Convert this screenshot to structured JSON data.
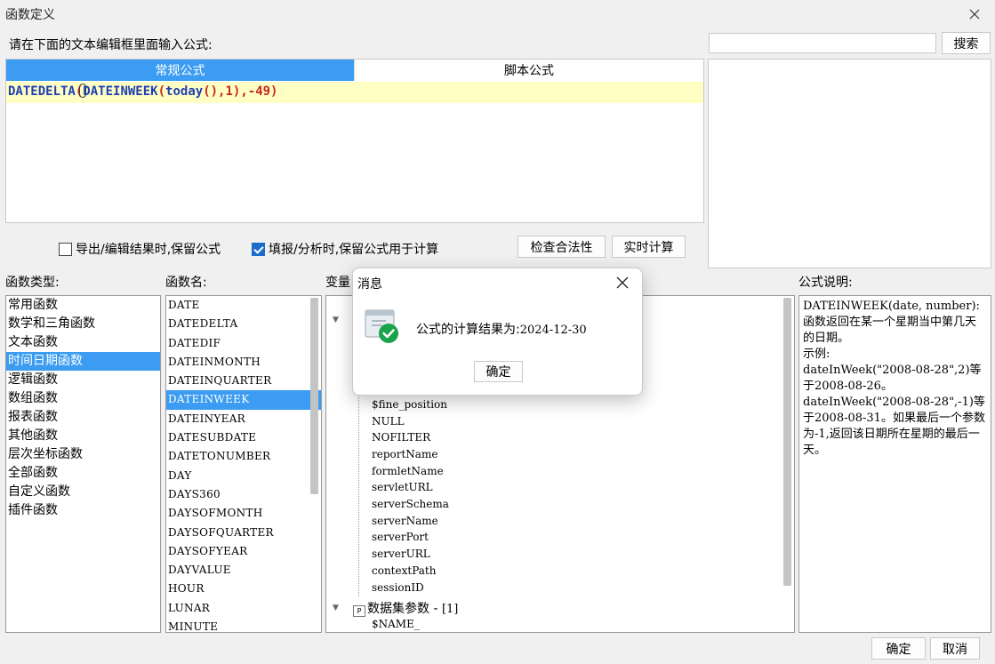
{
  "window": {
    "title": "函数定义",
    "close_icon": "close-icon"
  },
  "editor": {
    "prompt": "请在下面的文本编辑框里面输入公式:",
    "tabs": [
      {
        "label": "常规公式",
        "active": true
      },
      {
        "label": "脚本公式",
        "active": false
      }
    ],
    "formula_parts": {
      "fn1": "DATEDELTA",
      "p1": "(",
      "fn2": "DATEINWEEK",
      "p2": "(",
      "fn3": "today",
      "p3": "()",
      "args": ",1),-49)"
    }
  },
  "search": {
    "value": "",
    "button": "搜索"
  },
  "options": {
    "export_keep": {
      "label": "导出/编辑结果时,保留公式",
      "checked": false
    },
    "fill_keep": {
      "label": "填报/分析时,保留公式用于计算",
      "checked": true
    },
    "check_button": "检查合法性",
    "realtime_button": "实时计算"
  },
  "labels": {
    "category": "函数类型:",
    "function": "函数名:",
    "variable": "变量",
    "description": "公式说明:"
  },
  "categories": [
    "常用函数",
    "数学和三角函数",
    "文本函数",
    "时间日期函数",
    "逻辑函数",
    "数组函数",
    "报表函数",
    "其他函数",
    "层次坐标函数",
    "全部函数",
    "自定义函数",
    "插件函数"
  ],
  "selected_category": 3,
  "functions": [
    "DATE",
    "DATEDELTA",
    "DATEDIF",
    "DATEINMONTH",
    "DATEINQUARTER",
    "DATEINWEEK",
    "DATEINYEAR",
    "DATESUBDATE",
    "DATETONUMBER",
    "DAY",
    "DAYS360",
    "DAYSOFMONTH",
    "DAYSOFQUARTER",
    "DAYSOFYEAR",
    "DAYVALUE",
    "HOUR",
    "LUNAR",
    "MINUTE"
  ],
  "selected_function": 5,
  "variables": [
    "$fine_position",
    "NULL",
    "NOFILTER",
    "reportName",
    "formletName",
    "servletURL",
    "serverSchema",
    "serverName",
    "serverPort",
    "serverURL",
    "contextPath",
    "sessionID"
  ],
  "dataset_params": {
    "label": "数据集参数 - ",
    "count": "[1]",
    "items": [
      "$NAME_"
    ]
  },
  "description": [
    "DATEINWEEK(date, number):函数返回在某一个星期当中第几天的日期。",
    "示例:",
    "dateInWeek(\"2008-08-28\",2)等于2008-08-26。",
    "dateInWeek(\"2008-08-28\",-1)等于2008-08-31。如果最后一个参数为-1,返回该日期所在星期的最后一天。"
  ],
  "footer": {
    "ok": "确定",
    "cancel": "取消"
  },
  "message_dialog": {
    "title": "消息",
    "text_prefix": "公式的计算结果为:",
    "result": "2024-12-30",
    "ok": "确定",
    "icon": "success-check-icon"
  }
}
